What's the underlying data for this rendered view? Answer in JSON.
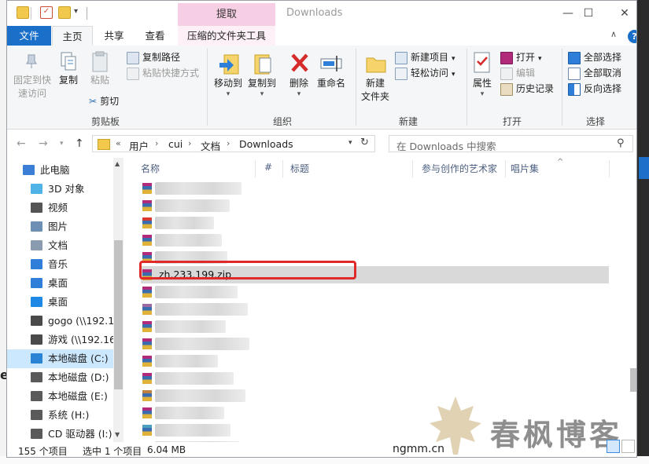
{
  "window": {
    "title": "Downloads"
  },
  "context_tab": {
    "label": "提取"
  },
  "tabs": {
    "file": "文件",
    "home": "主页",
    "share": "共享",
    "view": "查看",
    "compressed_tools": "压缩的文件夹工具"
  },
  "ribbon": {
    "clipboard": {
      "label": "剪贴板",
      "pin": "固定到快\n速访问",
      "copy": "复制",
      "paste": "粘贴",
      "copy_path": "复制路径",
      "paste_shortcut": "粘贴快捷方式",
      "cut": "剪切"
    },
    "organize": {
      "label": "组织",
      "move_to": "移动到",
      "copy_to": "复制到",
      "delete": "删除",
      "rename": "重命名"
    },
    "new": {
      "label": "新建",
      "new_folder": "新建\n文件夹",
      "new_item": "新建项目",
      "easy_access": "轻松访问"
    },
    "open": {
      "label": "打开",
      "properties": "属性",
      "open": "打开",
      "edit": "编辑",
      "history": "历史记录"
    },
    "select": {
      "label": "选择",
      "select_all": "全部选择",
      "select_none": "全部取消",
      "invert": "反向选择"
    }
  },
  "address": {
    "crumbs": [
      "用户",
      "cui",
      "文档",
      "Downloads"
    ],
    "prefix": "«",
    "search_placeholder": "在 Downloads 中搜索"
  },
  "nav": {
    "items": [
      {
        "label": "此电脑",
        "icon": "pc-icon",
        "color": "#3a7fd5"
      },
      {
        "label": "3D 对象",
        "icon": "cube-icon",
        "color": "#4fb3e8"
      },
      {
        "label": "视频",
        "icon": "film-icon",
        "color": "#555555"
      },
      {
        "label": "图片",
        "icon": "picture-icon",
        "color": "#6d8fb3"
      },
      {
        "label": "文档",
        "icon": "document-icon",
        "color": "#8a9bb0"
      },
      {
        "label": "音乐",
        "icon": "music-icon",
        "color": "#2f7ed8"
      },
      {
        "label": "桌面",
        "icon": "download-arrow-icon",
        "color": "#2f7ed8"
      },
      {
        "label": "桌面",
        "icon": "desktop-icon",
        "color": "#1e88e5"
      },
      {
        "label": "gogo (\\\\192.1",
        "icon": "network-drive-icon",
        "color": "#4a4a4a"
      },
      {
        "label": "游戏 (\\\\192.16",
        "icon": "network-drive-icon",
        "color": "#4a4a4a"
      },
      {
        "label": "本地磁盘 (C:)",
        "icon": "drive-c-icon",
        "color": "#2b83d6"
      },
      {
        "label": "本地磁盘 (D:)",
        "icon": "drive-icon",
        "color": "#5a5a5a"
      },
      {
        "label": "本地磁盘 (E:)",
        "icon": "drive-icon",
        "color": "#5a5a5a"
      },
      {
        "label": "系统 (H:)",
        "icon": "drive-icon",
        "color": "#5a5a5a"
      },
      {
        "label": "CD 驱动器 (I:)",
        "icon": "cd-drive-icon",
        "color": "#5a5a5a"
      }
    ],
    "selected_index": 10
  },
  "columns": {
    "name": "名称",
    "number": "#",
    "title": "标题",
    "contributing_artists": "参与创作的艺术家",
    "album": "唱片集"
  },
  "files": {
    "visible_name": "zh.233.199.zip",
    "selected_row": 5
  },
  "status": {
    "count": "155 个项目",
    "selected": "选中 1 个项目",
    "size": "6.04 MB"
  },
  "watermark": {
    "text": "春枫博客",
    "site": "ngmm.cn"
  },
  "edge_text": {
    "left_letter": "e"
  },
  "colors": {
    "accent": "#1a6fc9",
    "highlight": "#e02a2a",
    "selection": "#cce8ff",
    "context_tab": "#f7cfe4"
  }
}
